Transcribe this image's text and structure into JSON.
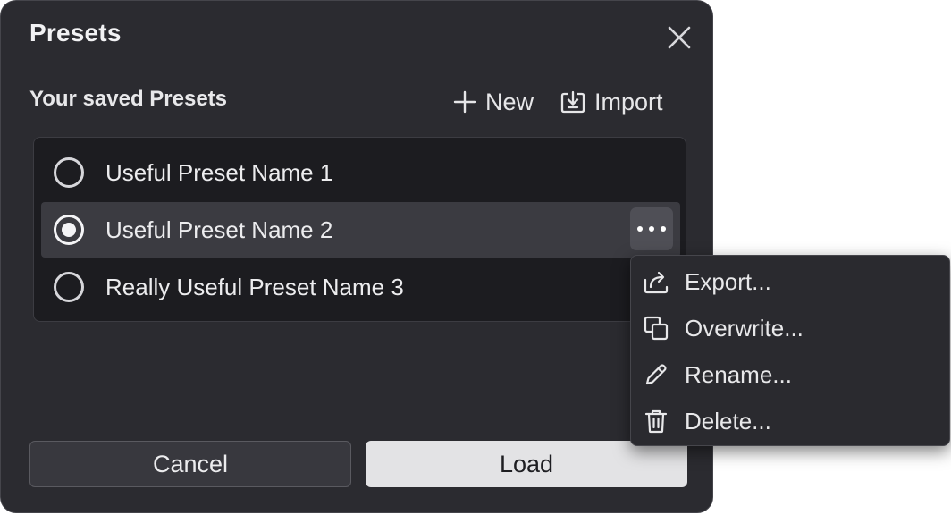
{
  "dialog": {
    "title": "Presets",
    "section_title": "Your saved Presets",
    "new_label": "New",
    "import_label": "Import"
  },
  "presets": [
    {
      "label": "Useful Preset Name 1",
      "selected": false
    },
    {
      "label": "Useful Preset Name 2",
      "selected": true
    },
    {
      "label": "Really Useful Preset Name 3",
      "selected": false
    }
  ],
  "buttons": {
    "cancel_label": "Cancel",
    "load_label": "Load"
  },
  "context_menu": {
    "items": [
      {
        "label": "Export...",
        "icon": "export-icon"
      },
      {
        "label": "Overwrite...",
        "icon": "overwrite-icon"
      },
      {
        "label": "Rename...",
        "icon": "pencil-icon"
      },
      {
        "label": "Delete...",
        "icon": "trash-icon"
      }
    ]
  },
  "colors": {
    "dialog_bg": "#2b2b30",
    "list_bg": "#1c1c20",
    "selected_row": "#3b3b41",
    "primary_button": "#e3e3e5"
  }
}
